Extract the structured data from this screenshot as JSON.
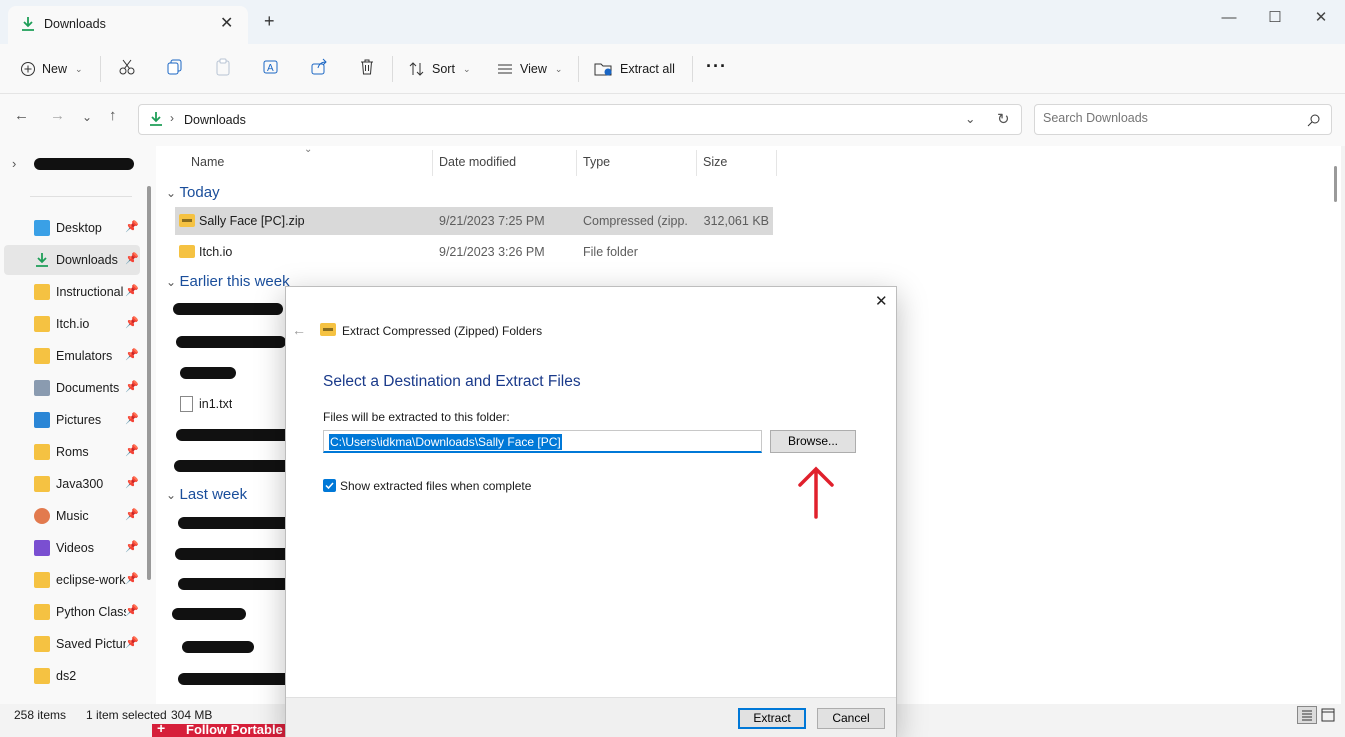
{
  "window": {
    "tab_title": "Downloads",
    "new_tab": "+",
    "tab_close": "✕",
    "minimize": "—",
    "maximize": "☐",
    "close": "✕"
  },
  "toolbar": {
    "new_label": "New",
    "sort_label": "Sort",
    "view_label": "View",
    "extract_all_label": "Extract all",
    "more_label": "···"
  },
  "address": {
    "path": "Downloads",
    "search_placeholder": "Search Downloads"
  },
  "nav": {
    "items": [
      {
        "label": "Desktop",
        "icon": "desktop-icon",
        "pinned": true
      },
      {
        "label": "Downloads",
        "icon": "download-icon",
        "pinned": true
      },
      {
        "label": "Instructional",
        "icon": "folder-icon",
        "pinned": true
      },
      {
        "label": "Itch.io",
        "icon": "folder-icon",
        "pinned": true
      },
      {
        "label": "Emulators",
        "icon": "folder-icon",
        "pinned": true
      },
      {
        "label": "Documents",
        "icon": "documents-icon",
        "pinned": true
      },
      {
        "label": "Pictures",
        "icon": "pictures-icon",
        "pinned": true
      },
      {
        "label": "Roms",
        "icon": "folder-icon",
        "pinned": true
      },
      {
        "label": "Java300",
        "icon": "folder-icon",
        "pinned": true
      },
      {
        "label": "Music",
        "icon": "music-icon",
        "pinned": true
      },
      {
        "label": "Videos",
        "icon": "videos-icon",
        "pinned": true
      },
      {
        "label": "eclipse-work",
        "icon": "folder-icon",
        "pinned": true
      },
      {
        "label": "Python Class",
        "icon": "folder-icon",
        "pinned": true
      },
      {
        "label": "Saved Picture",
        "icon": "folder-icon",
        "pinned": true
      },
      {
        "label": "ds2",
        "icon": "folder-icon",
        "pinned": false
      }
    ]
  },
  "columns": {
    "name": "Name",
    "date": "Date modified",
    "type": "Type",
    "size": "Size"
  },
  "groups": {
    "today": "Today",
    "earlier": "Earlier this week",
    "last_week": "Last week"
  },
  "files": {
    "today": [
      {
        "name": "Sally Face [PC].zip",
        "date": "9/21/2023 7:25 PM",
        "type": "Compressed (zipp...",
        "size": "312,061 KB"
      },
      {
        "name": "Itch.io",
        "date": "9/21/2023 3:26 PM",
        "type": "File folder",
        "size": ""
      }
    ],
    "visible_earlier": "in1.txt"
  },
  "status": {
    "count": "258 items",
    "selection": "1 item selected",
    "size": "304 MB"
  },
  "dialog": {
    "title": "Extract Compressed (Zipped) Folders",
    "heading": "Select a Destination and Extract Files",
    "folder_label": "Files will be extracted to this folder:",
    "path_value": "C:\\Users\\idkma\\Downloads\\Sally Face [PC]",
    "browse": "Browse...",
    "show_files": "Show extracted files when complete",
    "show_checked": true,
    "extract": "Extract",
    "cancel": "Cancel",
    "close": "✕"
  },
  "background_banner": "Follow Portable",
  "colors": {
    "accent": "#0078d7",
    "group_heading": "#1a4e9b",
    "annotation_arrow": "#e0202c"
  }
}
